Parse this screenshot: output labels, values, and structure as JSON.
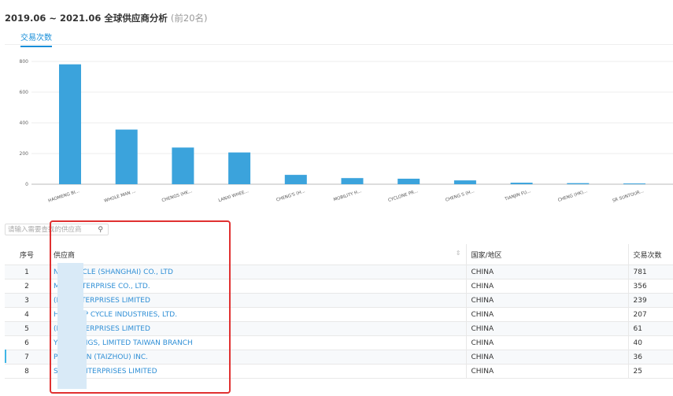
{
  "header": {
    "title": "2019.06 ~ 2021.06 全球供应商分析",
    "subtitle": "(前20名)"
  },
  "tabs": [
    {
      "label": "交易次数"
    }
  ],
  "chart_data": {
    "type": "bar",
    "categories": [
      "HAOMENG BI...",
      "WHOLE MAN ...",
      "CHENGS (HK...",
      "LANXI WHEE...",
      "CHENG'S (H...",
      "MOBILITY H...",
      "CYCLONE PR...",
      "CHENG S (H...",
      "TIANJIN FU...",
      "CHENG (HK)...",
      "SR SUNTOUR...",
      "AKIBO"
    ],
    "values": [
      781,
      356,
      239,
      207,
      61,
      40,
      36,
      25,
      10,
      7,
      5,
      0
    ],
    "ylim": [
      0,
      800
    ],
    "yticks": [
      "0",
      "200",
      "400",
      "600",
      "800"
    ],
    "grid": true,
    "color": "#3ba3dc"
  },
  "search": {
    "placeholder": "请输入需要查找的供应商",
    "icon": "search-icon"
  },
  "table": {
    "headers": {
      "index": "序号",
      "supplier": "供应商",
      "country": "国家/地区",
      "count": "交易次数"
    },
    "rows": [
      {
        "index": "1",
        "supplier": "NG BICYCLE (SHANGHAI) CO., LTD",
        "country": "CHINA",
        "count": "781"
      },
      {
        "index": "2",
        "supplier": "MAN ENTERPRISE CO., LTD.",
        "country": "CHINA",
        "count": "356"
      },
      {
        "index": "3",
        "supplier": "(HK) ENTERPRISES LIMITED",
        "country": "CHINA",
        "count": "239"
      },
      {
        "index": "4",
        "supplier": "HEEL TOP CYCLE INDUSTRIES, LTD.",
        "country": "CHINA",
        "count": "207"
      },
      {
        "index": "5",
        "supplier": "(HK) ENTERPRISES LIMITED",
        "country": "CHINA",
        "count": "61"
      },
      {
        "index": "6",
        "supplier": "Y HOLDINGS, LIMITED TAIWAN BRANCH",
        "country": "CHINA",
        "count": "40"
      },
      {
        "index": "7",
        "supplier": "PRECISION (TAIZHOU) INC.",
        "country": "CHINA",
        "count": "36"
      },
      {
        "index": "8",
        "supplier": "S (HK) ENTERPRISES LIMITED",
        "country": "CHINA",
        "count": "25"
      }
    ]
  }
}
